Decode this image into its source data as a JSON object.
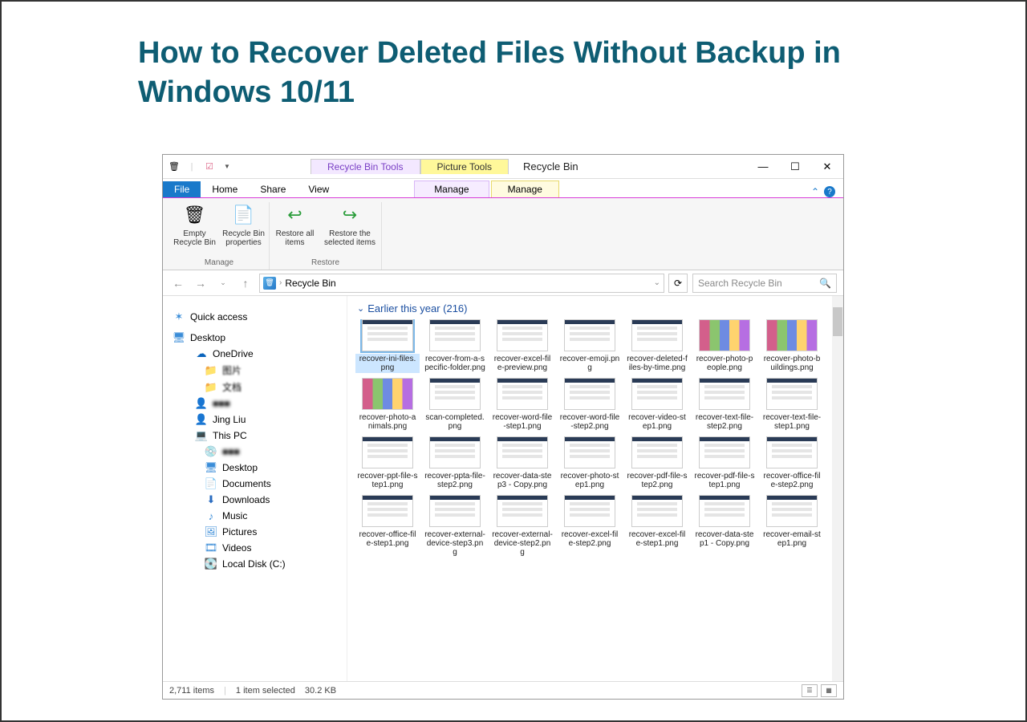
{
  "article": {
    "title": "How to Recover Deleted Files Without Backup in Windows 10/11"
  },
  "title_tabs": {
    "purple": "Recycle Bin Tools",
    "yellow": "Picture Tools"
  },
  "window_title": "Recycle Bin",
  "main_tabs": {
    "file": "File",
    "home": "Home",
    "share": "Share",
    "view": "View",
    "manage1": "Manage",
    "manage2": "Manage"
  },
  "ribbon": {
    "manage": {
      "name": "Manage",
      "empty": "Empty Recycle Bin",
      "props": "Recycle Bin properties"
    },
    "restore": {
      "name": "Restore",
      "all": "Restore all items",
      "selected": "Restore the selected items"
    }
  },
  "breadcrumb": {
    "text": "Recycle Bin"
  },
  "search": {
    "placeholder": "Search Recycle Bin"
  },
  "nav": {
    "quick": "Quick access",
    "desktop_root": "Desktop",
    "onedrive": "OneDrive",
    "od_item1": "图片",
    "od_item2": "文档",
    "user_blur": "■■■",
    "jing": "Jing Liu",
    "thispc": "This PC",
    "pc_blur": "■■■",
    "desktop": "Desktop",
    "documents": "Documents",
    "downloads": "Downloads",
    "music": "Music",
    "pictures": "Pictures",
    "videos": "Videos",
    "localc": "Local Disk (C:)"
  },
  "group_header": "Earlier this year (216)",
  "files": [
    {
      "name": "recover-ini-files.png",
      "sel": true
    },
    {
      "name": "recover-from-a-specific-folder.png"
    },
    {
      "name": "recover-excel-file-preview.png"
    },
    {
      "name": "recover-emoji.png"
    },
    {
      "name": "recover-deleted-files-by-time.png"
    },
    {
      "name": "recover-photo-people.png",
      "photos": true
    },
    {
      "name": "recover-photo-buildings.png",
      "photos": true
    },
    {
      "name": "recover-photo-animals.png",
      "photos": true
    },
    {
      "name": "scan-completed.png"
    },
    {
      "name": "recover-word-file-step1.png"
    },
    {
      "name": "recover-word-file-step2.png"
    },
    {
      "name": "recover-video-step1.png"
    },
    {
      "name": "recover-text-file-step2.png"
    },
    {
      "name": "recover-text-file-step1.png"
    },
    {
      "name": "recover-ppt-file-step1.png"
    },
    {
      "name": "recover-ppta-file-step2.png"
    },
    {
      "name": "recover-data-step3 - Copy.png"
    },
    {
      "name": "recover-photo-step1.png"
    },
    {
      "name": "recover-pdf-file-step2.png"
    },
    {
      "name": "recover-pdf-file-step1.png"
    },
    {
      "name": "recover-office-file-step2.png"
    },
    {
      "name": "recover-office-file-step1.png"
    },
    {
      "name": "recover-external-device-step3.png"
    },
    {
      "name": "recover-external-device-step2.png"
    },
    {
      "name": "recover-excel-file-step2.png"
    },
    {
      "name": "recover-excel-file-step1.png"
    },
    {
      "name": "recover-data-step1 - Copy.png"
    },
    {
      "name": "recover-email-step1.png"
    }
  ],
  "status": {
    "total": "2,711 items",
    "selected": "1 item selected",
    "size": "30.2 KB"
  }
}
